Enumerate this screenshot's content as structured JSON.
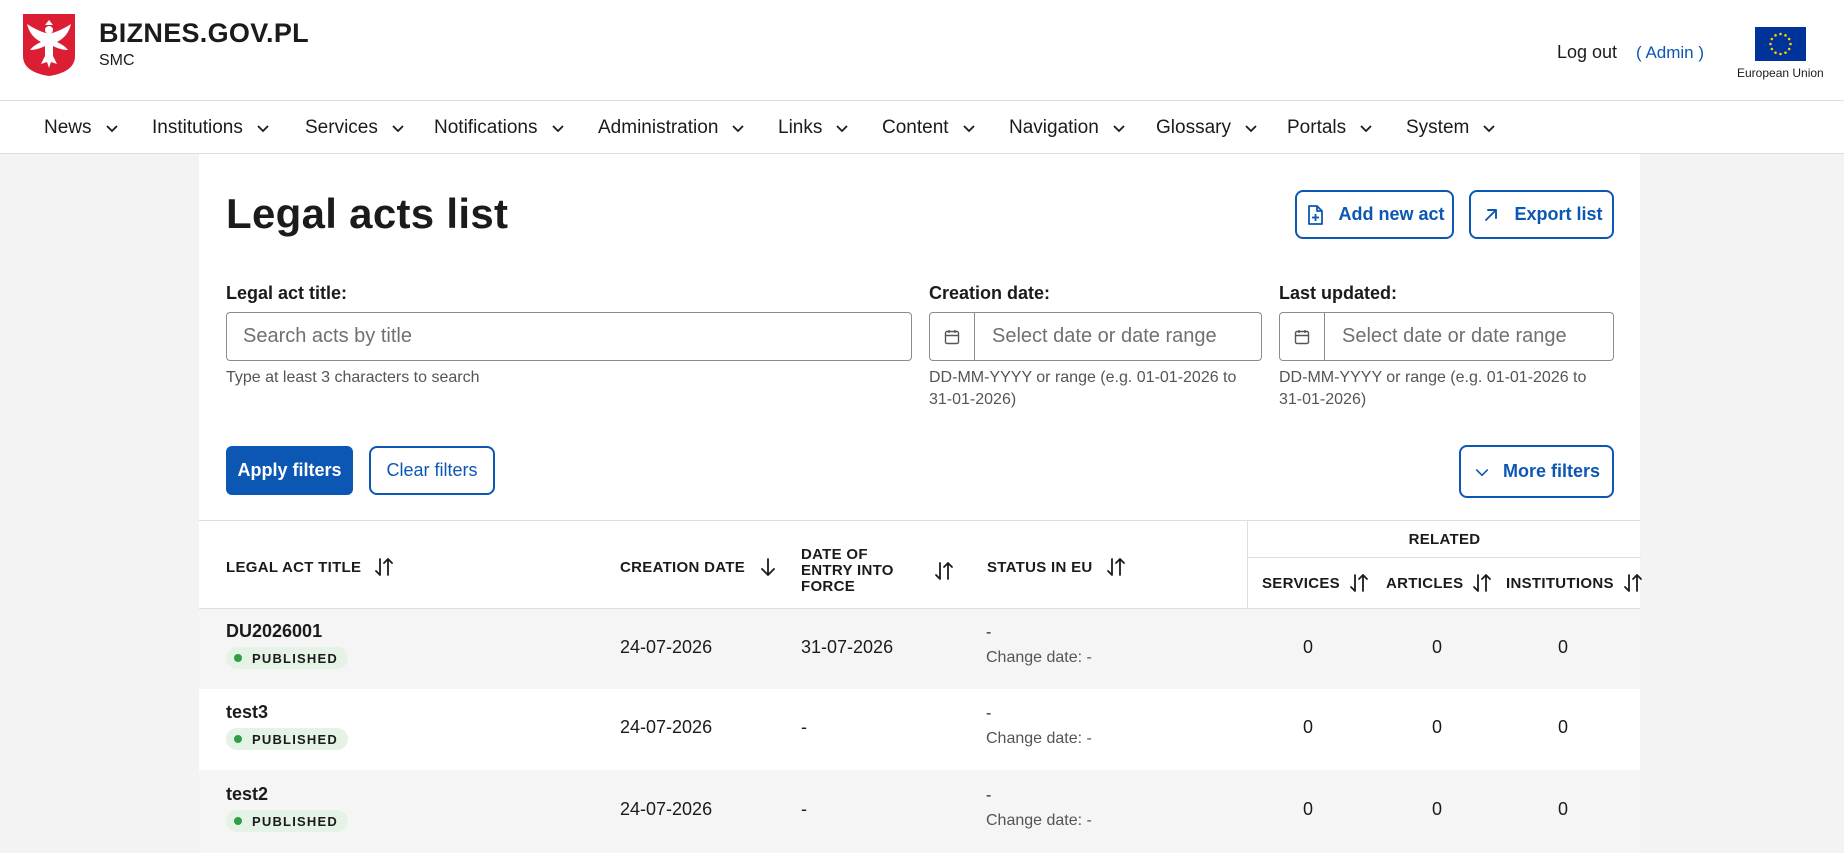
{
  "header": {
    "brand_title": "BIZNES.GOV.PL",
    "brand_sub": "SMC",
    "logout_label": "Log out",
    "admin_label": "( Admin )",
    "eu_label": "European Union",
    "icons": {
      "emblem": "polish-eagle-emblem-icon",
      "eu": "eu-flag-icon"
    },
    "colors": {
      "emblem_red": "#dc1e35",
      "eu_blue": "#003399",
      "eu_star": "#ffcc00"
    }
  },
  "nav": {
    "items": [
      {
        "label": "News"
      },
      {
        "label": "Institutions"
      },
      {
        "label": "Services"
      },
      {
        "label": "Notifications"
      },
      {
        "label": "Administration"
      },
      {
        "label": "Links"
      },
      {
        "label": "Content"
      },
      {
        "label": "Navigation"
      },
      {
        "label": "Glossary"
      },
      {
        "label": "Portals"
      },
      {
        "label": "System"
      }
    ]
  },
  "page": {
    "title": "Legal acts list",
    "add_button": "Add new act",
    "export_button": "Export list"
  },
  "filters": {
    "title": {
      "label": "Legal act title:",
      "placeholder": "Search acts by title",
      "value": "",
      "hint": "Type at least 3 characters to search"
    },
    "created": {
      "label": "Creation date:",
      "placeholder": "Select date or date range",
      "value": "",
      "hint": "DD-MM-YYYY or range (e.g. 01-01-2026 to 31-01-2026)"
    },
    "updated": {
      "label": "Last updated:",
      "placeholder": "Select date or date range",
      "value": "",
      "hint": "DD-MM-YYYY or range (e.g. 01-01-2026 to 31-01-2026)"
    },
    "apply_label": "Apply filters",
    "clear_label": "Clear filters",
    "more_label": "More filters"
  },
  "table": {
    "columns": {
      "title": "LEGAL ACT TITLE",
      "created": "CREATION DATE",
      "entry_force": "DATE OF ENTRY INTO FORCE",
      "status_eu": "STATUS IN EU",
      "related": "RELATED",
      "services": "SERVICES",
      "articles": "ARTICLES",
      "institutions": "INSTITUTIONS"
    },
    "rows": [
      {
        "title": "DU2026001",
        "status": "PUBLISHED",
        "created": "24-07-2026",
        "entry_force": "31-07-2026",
        "status_eu": "-",
        "change_date": "Change date: -",
        "services": "0",
        "articles": "0",
        "institutions": "0"
      },
      {
        "title": "test3",
        "status": "PUBLISHED",
        "created": "24-07-2026",
        "entry_force": "-",
        "status_eu": "-",
        "change_date": "Change date: -",
        "services": "0",
        "articles": "0",
        "institutions": "0"
      },
      {
        "title": "test2",
        "status": "PUBLISHED",
        "created": "24-07-2026",
        "entry_force": "-",
        "status_eu": "-",
        "change_date": "Change date: -",
        "services": "0",
        "articles": "0",
        "institutions": "0"
      }
    ]
  },
  "theme": {
    "accent": "#0b57b3",
    "published_dot": "#2f9e44",
    "published_bg": "#e4f3e6"
  }
}
